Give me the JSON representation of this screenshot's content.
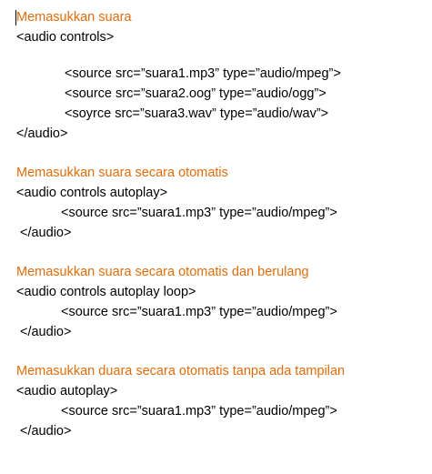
{
  "colors": {
    "heading": "#e36c0a",
    "code": "#000000",
    "background": "#ffffff"
  },
  "sections": [
    {
      "heading": "Memasukkan suara",
      "lines": [
        "<audio controls>",
        "<source src=”suara1.mp3” type=”audio/mpeg”>",
        "<source src=”suara2.oog” type=”audio/ogg”>",
        "<soyrce src=”suara3.wav” type=”audio/wav”>",
        "</audio>"
      ]
    },
    {
      "heading": "Memasukkan suara secara otomatis",
      "lines": [
        "<audio controls autoplay>",
        "<source src=”suara1.mp3” type=”audio/mpeg”>",
        "</audio>"
      ]
    },
    {
      "heading": "Memasukkan suara secara otomatis dan berulang",
      "lines": [
        "<audio controls autoplay loop>",
        "<source src=”suara1.mp3” type=”audio/mpeg”>",
        "</audio>"
      ]
    },
    {
      "heading": "Memasukkan duara secara otomatis tanpa ada tampilan",
      "lines": [
        "<audio autoplay>",
        "<source src=”suara1.mp3” type=”audio/mpeg”>",
        "</audio>"
      ]
    }
  ]
}
